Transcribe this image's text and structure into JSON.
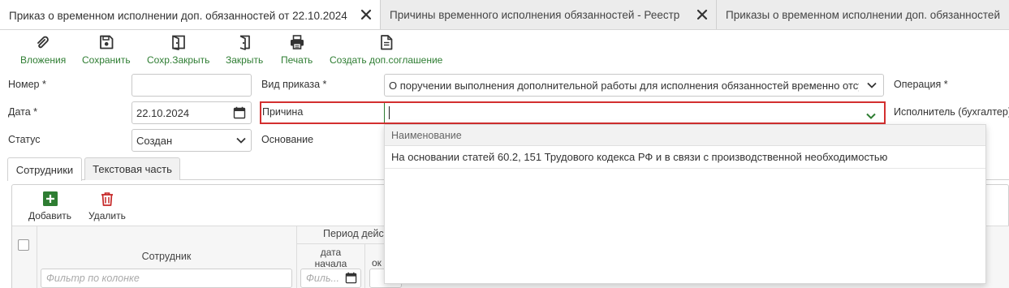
{
  "tabs": [
    {
      "label": "Приказ о временном исполнении доп. обязанностей от 22.10.2024",
      "active": true
    },
    {
      "label": "Причины временного исполнения обязанностей - Реестр",
      "active": false
    },
    {
      "label": "Приказы о временном исполнении доп. обязанностей",
      "active": false
    }
  ],
  "toolbar": {
    "attachments": "Вложения",
    "save": "Сохранить",
    "save_close": "Сохр.Закрыть",
    "close": "Закрыть",
    "print": "Печать",
    "create_agreement": "Создать доп.соглашение"
  },
  "form": {
    "number_label": "Номер *",
    "number_value": "",
    "date_label": "Дата *",
    "date_value": "22.10.2024",
    "status_label": "Статус",
    "status_value": "Создан",
    "order_type_label": "Вид приказа *",
    "order_type_value": "О поручении выполнения дополнительной работы  для исполнения обязанностей временно отсутствующего работника",
    "reason_label": "Причина",
    "reason_value": "",
    "basis_label": "Основание",
    "operation_label": "Операция *",
    "executor_label": "Исполнитель (бухгалтер)"
  },
  "dropdown": {
    "header": "Наименование",
    "options": [
      "На основании статей 60.2, 151 Трудового кодекса РФ и в связи с производственной необходимостью"
    ]
  },
  "inner_tabs": [
    {
      "label": "Сотрудники",
      "active": true
    },
    {
      "label": "Текстовая часть",
      "active": false
    }
  ],
  "grid": {
    "add": "Добавить",
    "delete": "Удалить",
    "col_employee": "Сотрудник",
    "col_period": "Период действия",
    "col_start_line1": "дата",
    "col_start_line2": "начала",
    "col_end_partial": "ок",
    "filter_placeholder": "Фильтр по колонке",
    "filter_short": "Филь..."
  },
  "colors": {
    "accent_green": "#2e7d32",
    "error_red": "#d32f2f",
    "delete_red": "#c62828"
  }
}
